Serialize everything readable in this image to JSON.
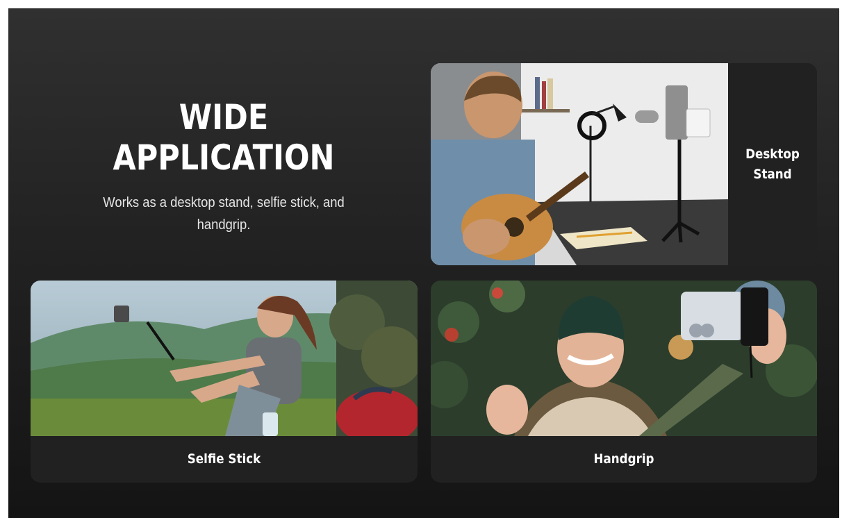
{
  "headline": {
    "title_line1": "WIDE",
    "title_line2": "APPLICATION",
    "subtitle": "Works as a desktop stand, selfie stick, and handgrip."
  },
  "cards": {
    "desktop": {
      "label": "Desktop\nStand",
      "photo": "man-playing-guitar-desktop-stand-photo"
    },
    "selfie": {
      "label": "Selfie Stick",
      "photo": "hiker-selfie-stick-photo"
    },
    "handgrip": {
      "label": "Handgrip",
      "photo": "woman-handgrip-selfie-photo"
    }
  },
  "colors": {
    "background_top": "#303030",
    "background_bottom": "#141414",
    "card": "#212121",
    "text": "#ffffff"
  }
}
